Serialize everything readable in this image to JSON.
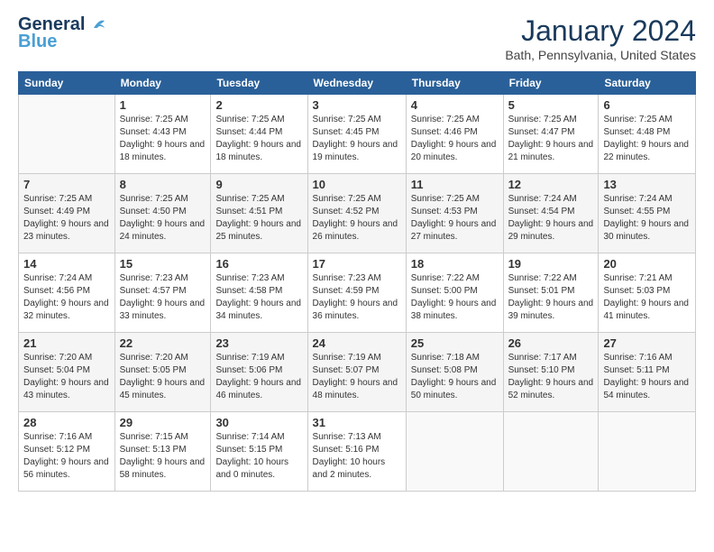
{
  "header": {
    "logo_line1": "General",
    "logo_line2": "Blue",
    "month": "January 2024",
    "location": "Bath, Pennsylvania, United States"
  },
  "days_of_week": [
    "Sunday",
    "Monday",
    "Tuesday",
    "Wednesday",
    "Thursday",
    "Friday",
    "Saturday"
  ],
  "weeks": [
    [
      {
        "day": "",
        "sunrise": "",
        "sunset": "",
        "daylight": ""
      },
      {
        "day": "1",
        "sunrise": "Sunrise: 7:25 AM",
        "sunset": "Sunset: 4:43 PM",
        "daylight": "Daylight: 9 hours and 18 minutes."
      },
      {
        "day": "2",
        "sunrise": "Sunrise: 7:25 AM",
        "sunset": "Sunset: 4:44 PM",
        "daylight": "Daylight: 9 hours and 18 minutes."
      },
      {
        "day": "3",
        "sunrise": "Sunrise: 7:25 AM",
        "sunset": "Sunset: 4:45 PM",
        "daylight": "Daylight: 9 hours and 19 minutes."
      },
      {
        "day": "4",
        "sunrise": "Sunrise: 7:25 AM",
        "sunset": "Sunset: 4:46 PM",
        "daylight": "Daylight: 9 hours and 20 minutes."
      },
      {
        "day": "5",
        "sunrise": "Sunrise: 7:25 AM",
        "sunset": "Sunset: 4:47 PM",
        "daylight": "Daylight: 9 hours and 21 minutes."
      },
      {
        "day": "6",
        "sunrise": "Sunrise: 7:25 AM",
        "sunset": "Sunset: 4:48 PM",
        "daylight": "Daylight: 9 hours and 22 minutes."
      }
    ],
    [
      {
        "day": "7",
        "sunrise": "Sunrise: 7:25 AM",
        "sunset": "Sunset: 4:49 PM",
        "daylight": "Daylight: 9 hours and 23 minutes."
      },
      {
        "day": "8",
        "sunrise": "Sunrise: 7:25 AM",
        "sunset": "Sunset: 4:50 PM",
        "daylight": "Daylight: 9 hours and 24 minutes."
      },
      {
        "day": "9",
        "sunrise": "Sunrise: 7:25 AM",
        "sunset": "Sunset: 4:51 PM",
        "daylight": "Daylight: 9 hours and 25 minutes."
      },
      {
        "day": "10",
        "sunrise": "Sunrise: 7:25 AM",
        "sunset": "Sunset: 4:52 PM",
        "daylight": "Daylight: 9 hours and 26 minutes."
      },
      {
        "day": "11",
        "sunrise": "Sunrise: 7:25 AM",
        "sunset": "Sunset: 4:53 PM",
        "daylight": "Daylight: 9 hours and 27 minutes."
      },
      {
        "day": "12",
        "sunrise": "Sunrise: 7:24 AM",
        "sunset": "Sunset: 4:54 PM",
        "daylight": "Daylight: 9 hours and 29 minutes."
      },
      {
        "day": "13",
        "sunrise": "Sunrise: 7:24 AM",
        "sunset": "Sunset: 4:55 PM",
        "daylight": "Daylight: 9 hours and 30 minutes."
      }
    ],
    [
      {
        "day": "14",
        "sunrise": "Sunrise: 7:24 AM",
        "sunset": "Sunset: 4:56 PM",
        "daylight": "Daylight: 9 hours and 32 minutes."
      },
      {
        "day": "15",
        "sunrise": "Sunrise: 7:23 AM",
        "sunset": "Sunset: 4:57 PM",
        "daylight": "Daylight: 9 hours and 33 minutes."
      },
      {
        "day": "16",
        "sunrise": "Sunrise: 7:23 AM",
        "sunset": "Sunset: 4:58 PM",
        "daylight": "Daylight: 9 hours and 34 minutes."
      },
      {
        "day": "17",
        "sunrise": "Sunrise: 7:23 AM",
        "sunset": "Sunset: 4:59 PM",
        "daylight": "Daylight: 9 hours and 36 minutes."
      },
      {
        "day": "18",
        "sunrise": "Sunrise: 7:22 AM",
        "sunset": "Sunset: 5:00 PM",
        "daylight": "Daylight: 9 hours and 38 minutes."
      },
      {
        "day": "19",
        "sunrise": "Sunrise: 7:22 AM",
        "sunset": "Sunset: 5:01 PM",
        "daylight": "Daylight: 9 hours and 39 minutes."
      },
      {
        "day": "20",
        "sunrise": "Sunrise: 7:21 AM",
        "sunset": "Sunset: 5:03 PM",
        "daylight": "Daylight: 9 hours and 41 minutes."
      }
    ],
    [
      {
        "day": "21",
        "sunrise": "Sunrise: 7:20 AM",
        "sunset": "Sunset: 5:04 PM",
        "daylight": "Daylight: 9 hours and 43 minutes."
      },
      {
        "day": "22",
        "sunrise": "Sunrise: 7:20 AM",
        "sunset": "Sunset: 5:05 PM",
        "daylight": "Daylight: 9 hours and 45 minutes."
      },
      {
        "day": "23",
        "sunrise": "Sunrise: 7:19 AM",
        "sunset": "Sunset: 5:06 PM",
        "daylight": "Daylight: 9 hours and 46 minutes."
      },
      {
        "day": "24",
        "sunrise": "Sunrise: 7:19 AM",
        "sunset": "Sunset: 5:07 PM",
        "daylight": "Daylight: 9 hours and 48 minutes."
      },
      {
        "day": "25",
        "sunrise": "Sunrise: 7:18 AM",
        "sunset": "Sunset: 5:08 PM",
        "daylight": "Daylight: 9 hours and 50 minutes."
      },
      {
        "day": "26",
        "sunrise": "Sunrise: 7:17 AM",
        "sunset": "Sunset: 5:10 PM",
        "daylight": "Daylight: 9 hours and 52 minutes."
      },
      {
        "day": "27",
        "sunrise": "Sunrise: 7:16 AM",
        "sunset": "Sunset: 5:11 PM",
        "daylight": "Daylight: 9 hours and 54 minutes."
      }
    ],
    [
      {
        "day": "28",
        "sunrise": "Sunrise: 7:16 AM",
        "sunset": "Sunset: 5:12 PM",
        "daylight": "Daylight: 9 hours and 56 minutes."
      },
      {
        "day": "29",
        "sunrise": "Sunrise: 7:15 AM",
        "sunset": "Sunset: 5:13 PM",
        "daylight": "Daylight: 9 hours and 58 minutes."
      },
      {
        "day": "30",
        "sunrise": "Sunrise: 7:14 AM",
        "sunset": "Sunset: 5:15 PM",
        "daylight": "Daylight: 10 hours and 0 minutes."
      },
      {
        "day": "31",
        "sunrise": "Sunrise: 7:13 AM",
        "sunset": "Sunset: 5:16 PM",
        "daylight": "Daylight: 10 hours and 2 minutes."
      },
      {
        "day": "",
        "sunrise": "",
        "sunset": "",
        "daylight": ""
      },
      {
        "day": "",
        "sunrise": "",
        "sunset": "",
        "daylight": ""
      },
      {
        "day": "",
        "sunrise": "",
        "sunset": "",
        "daylight": ""
      }
    ]
  ]
}
